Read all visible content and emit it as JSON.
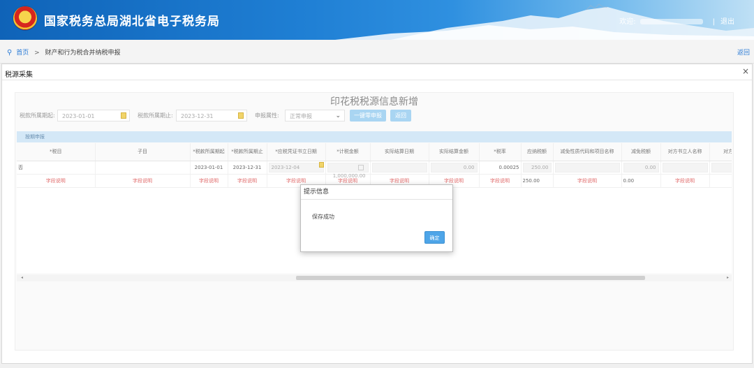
{
  "header": {
    "title": "国家税务总局湖北省电子税务局",
    "welcome": "欢迎",
    "separator": "|",
    "logout": "退出"
  },
  "breadcrumb": {
    "home": "首页",
    "arrow": ">",
    "current": "财产和行为税合并纳税申报",
    "back": "返回"
  },
  "panel": {
    "title": "税源采集",
    "close": "×"
  },
  "form": {
    "title": "印花税税源信息新增",
    "period_start_label": "税款所属期起:",
    "period_start_value": "2023-01-01",
    "period_end_label": "税款所属期止:",
    "period_end_value": "2023-12-31",
    "declare_attr_label": "申报属性:",
    "declare_attr_value": "正常申报",
    "btn_quick": "一键零申报",
    "btn_back": "返回"
  },
  "section": {
    "label": "按期申报"
  },
  "table": {
    "headers": [
      "*税目",
      "子目",
      "*税款所属期起",
      "*税款所属期止",
      "*应税凭证书立日期",
      "*计税金额",
      "实际结算日期",
      "实际结算金额",
      "*税率",
      "应纳税额",
      "减免性质代码和项目名称",
      "减免税额",
      "对方书立人名称",
      "对方书立"
    ],
    "row1": {
      "c0": "否",
      "c2": "2023-01-01",
      "c3": "2023-12-31",
      "c4": "2023-12-04",
      "c5": "1,000,000.00",
      "c7": "0.00",
      "c8": "0.00025",
      "c9": "250.00",
      "c11": "0.00"
    },
    "row2": {
      "link": "字段说明",
      "c9": "250.00",
      "c11": "0.00"
    }
  },
  "scroll": {
    "left_arrow": "◂",
    "right_arrow": "▸"
  },
  "modal": {
    "title": "提示信息",
    "message": "保存成功",
    "ok": "确定"
  }
}
